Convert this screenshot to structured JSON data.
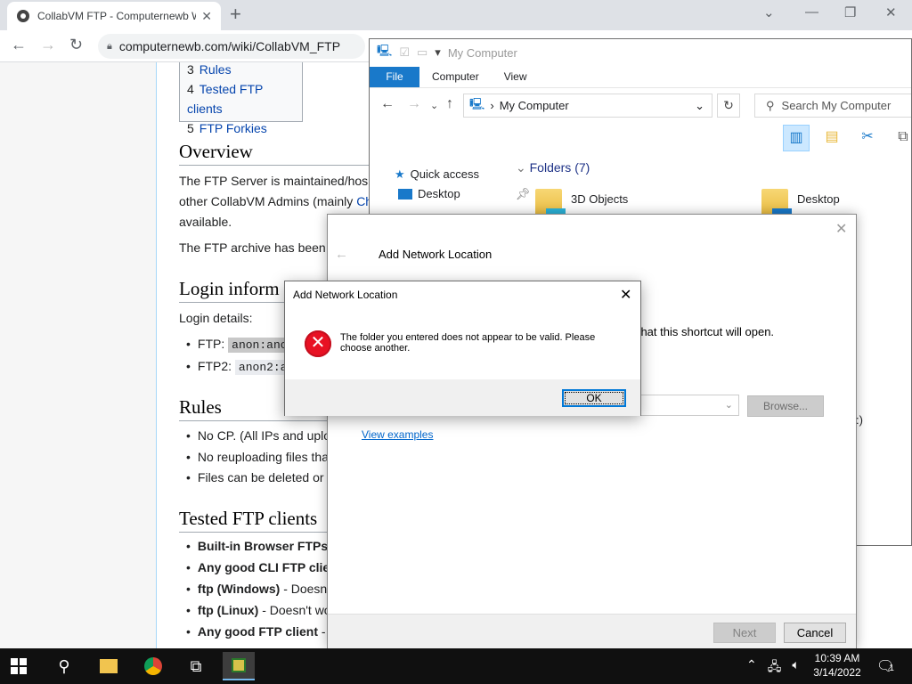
{
  "browser": {
    "tab_title": "CollabVM FTP - Computernewb Wiki",
    "url": "computernewb.com/wiki/CollabVM_FTP"
  },
  "wiki": {
    "toc": [
      {
        "num": "3",
        "label": "Rules"
      },
      {
        "num": "4",
        "label": "Tested FTP clients"
      },
      {
        "num": "5",
        "label": "FTP Forkies"
      }
    ],
    "overview_heading": "Overview",
    "overview_p1a": "The FTP Server is maintained/hos",
    "overview_p1b_pre": "other CollabVM Admins (mainly ",
    "overview_p1b_link": "Ch",
    "overview_p1c": "available.",
    "overview_p2": "The FTP archive has been",
    "login_heading": "Login inform",
    "login_details": "Login details:",
    "ftp1_label": "FTP:",
    "ftp1_code": "anon:anc",
    "ftp2_label": "FTP2:",
    "ftp2_code": "anon2:a",
    "rules_heading": "Rules",
    "rules": [
      "No CP. (All IPs and uplo",
      "No reuploading files tha",
      "Files can be deleted or"
    ],
    "clients_heading": "Tested FTP clients",
    "clients": [
      {
        "bold": "Built-in Browser FTPs",
        "rest": ""
      },
      {
        "bold": "Any good CLI FTP clie",
        "rest": ""
      },
      {
        "bold": "ftp (Windows)",
        "rest": " - Doesn"
      },
      {
        "bold": "ftp (Linux)",
        "rest": " - Doesn't wo"
      },
      {
        "bold": "Any good FTP client",
        "rest": " -"
      }
    ]
  },
  "explorer": {
    "title": "My Computer",
    "ribbon_tabs": [
      "File",
      "Computer",
      "View"
    ],
    "address": "My Computer",
    "search_placeholder": "Search My Computer",
    "quick_access": "Quick access",
    "nav_desktop": "Desktop",
    "folders_header": "Folders (7)",
    "folders": [
      "3D Objects",
      "Desktop"
    ],
    "side_glyph": ":)"
  },
  "wizard": {
    "title": "Add Network Location",
    "desc_tail": "n that this shortcut will open.",
    "browse_label": "Browse...",
    "view_examples": "View examples",
    "next_label": "Next",
    "cancel_label": "Cancel"
  },
  "error_dialog": {
    "title": "Add Network Location",
    "message": "The folder you entered does not appear to be valid.  Please choose another.",
    "ok_label": "OK"
  },
  "taskbar": {
    "time": "10:39 AM",
    "date": "3/14/2022",
    "notification_count": "1"
  }
}
